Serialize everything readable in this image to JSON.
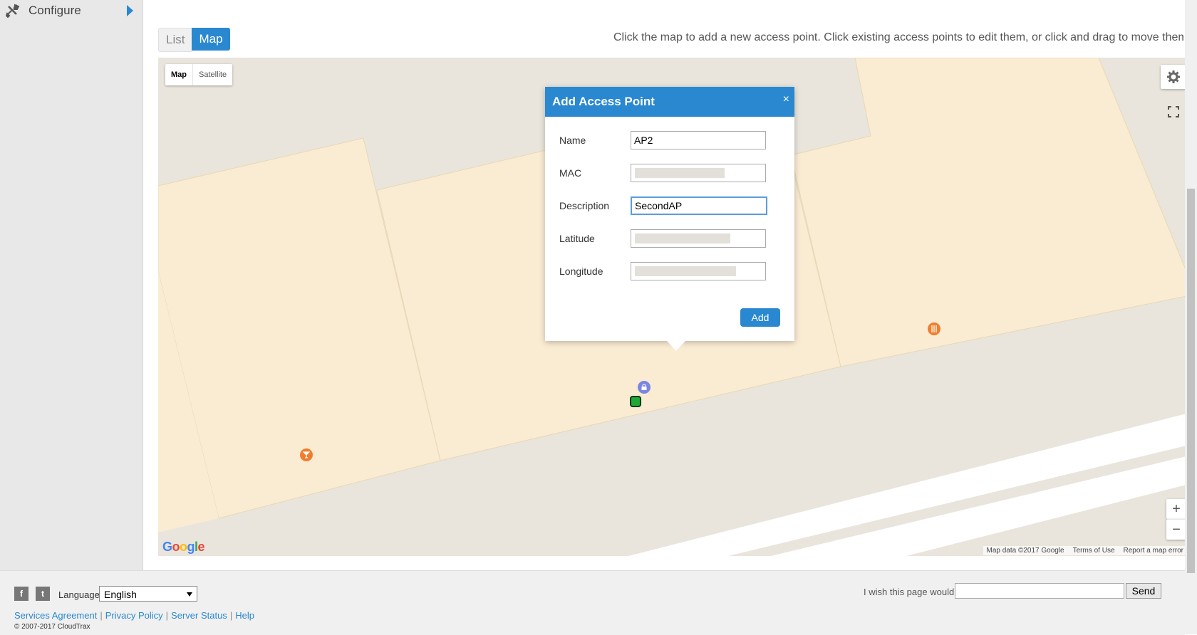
{
  "sidebar": {
    "configure_label": "Configure"
  },
  "view_toggle": {
    "list_label": "List",
    "map_label": "Map"
  },
  "instructions": "Click the map to add a new access point. Click existing access points to edit them, or click and drag to move them",
  "map": {
    "type_map": "Map",
    "type_satellite": "Satellite",
    "zoom_in": "+",
    "zoom_out": "−",
    "attribution": {
      "data": "Map data ©2017 Google",
      "terms": "Terms of Use",
      "report": "Report a map error"
    }
  },
  "dialog": {
    "title": "Add Access Point",
    "close": "×",
    "fields": {
      "name": {
        "label": "Name",
        "value": "AP2"
      },
      "mac": {
        "label": "MAC",
        "value": ""
      },
      "description": {
        "label": "Description",
        "value": "SecondAP"
      },
      "latitude": {
        "label": "Latitude",
        "value": ""
      },
      "longitude": {
        "label": "Longitude",
        "value": ""
      }
    },
    "add_label": "Add"
  },
  "footer": {
    "facebook": "f",
    "twitter": "t",
    "language_label": "Language:",
    "language_value": "English",
    "links": [
      "Services Agreement",
      "Privacy Policy",
      "Server Status",
      "Help"
    ],
    "copyright": "© 2007-2017 CloudTrax",
    "wish_label": "I wish this page would...",
    "send_label": "Send"
  },
  "colors": {
    "accent": "#2a88d0",
    "map_building": "#faebd3",
    "map_road": "#e9e5dc"
  }
}
